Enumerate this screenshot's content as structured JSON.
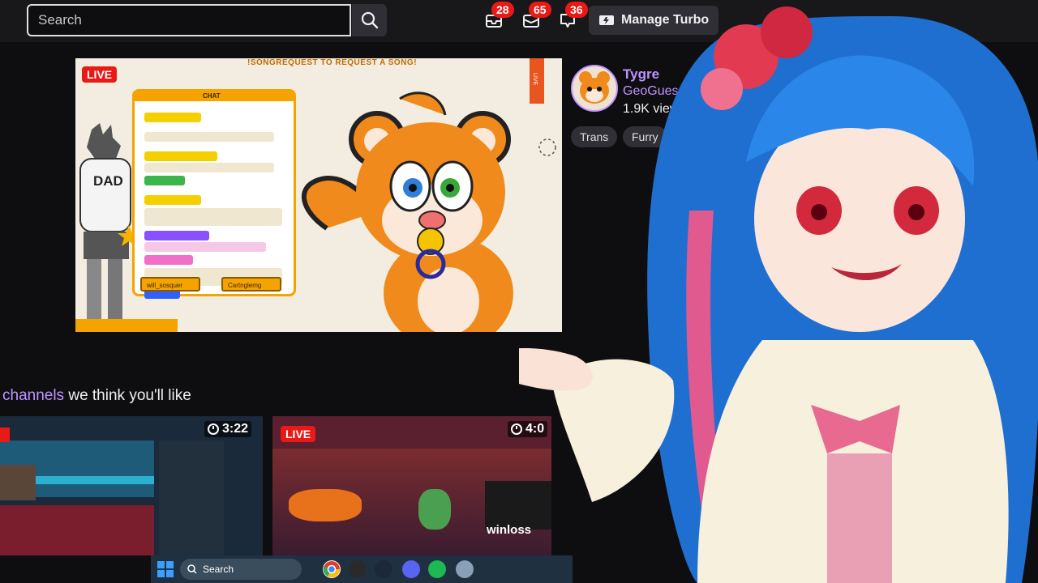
{
  "header": {
    "search_placeholder": "Search",
    "notifications": [
      {
        "icon": "inbox-icon",
        "count": "28"
      },
      {
        "icon": "mail-icon",
        "count": "65"
      },
      {
        "icon": "chat-bubble-icon",
        "count": "36"
      }
    ],
    "turbo_label": "Manage Turbo"
  },
  "stream": {
    "live_label": "LIVE",
    "song_banner": "!SONGREQUEST TO REQUEST A SONG!",
    "chat_header": "CHAT",
    "side_live": "LIVE",
    "character_shirt": "DAD",
    "chat_button_left": "will_sosquer",
    "chat_button_right": "Cartnglemg"
  },
  "channel": {
    "name": "Tygre",
    "game": "GeoGuessr",
    "viewers": "1.9K viewers",
    "tags": [
      "Trans",
      "Furry"
    ]
  },
  "recommended": {
    "title_highlight": "channels",
    "title_rest": " we think you'll like",
    "cards": [
      {
        "duration": "3:22"
      },
      {
        "live_label": "LIVE",
        "duration": "4:0",
        "overlay_text": "winloss"
      }
    ]
  },
  "taskbar": {
    "search_label": "Search",
    "icons": [
      "windows-start-icon",
      "chrome-icon",
      "obs-icon",
      "steam-icon",
      "discord-icon",
      "spotify-icon",
      "settings-icon"
    ]
  },
  "colors": {
    "bg": "#0e0e10",
    "topbar": "#18181b",
    "accent": "#bf94ff",
    "live_red": "#e91916"
  }
}
